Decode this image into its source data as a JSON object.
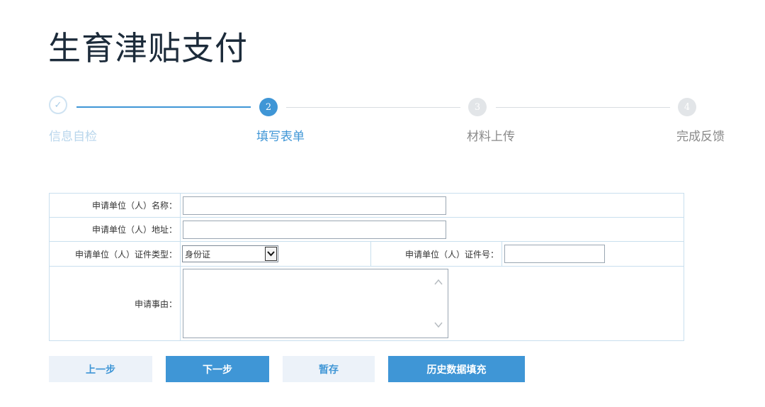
{
  "page": {
    "title": "生育津贴支付"
  },
  "steps": [
    {
      "label": "信息自检",
      "marker": "✓",
      "state": "done"
    },
    {
      "label": "填写表单",
      "marker": "2",
      "state": "active"
    },
    {
      "label": "材料上传",
      "marker": "3",
      "state": "pending"
    },
    {
      "label": "完成反馈",
      "marker": "4",
      "state": "pending"
    }
  ],
  "form": {
    "name_label": "申请单位（人）名称：",
    "name_value": "",
    "address_label": "申请单位（人）地址：",
    "address_value": "",
    "id_type_label": "申请单位（人）证件类型：",
    "id_type_value": "身份证",
    "id_number_label": "申请单位（人）证件号：",
    "id_number_value": "",
    "reason_label": "申请事由：",
    "reason_value": ""
  },
  "buttons": {
    "prev": "上一步",
    "next": "下一步",
    "save": "暂存",
    "history": "历史数据填充"
  },
  "colors": {
    "accent": "#3f96d6",
    "light_button": "#ecf2f9",
    "pending_step": "#e2e5e8"
  }
}
